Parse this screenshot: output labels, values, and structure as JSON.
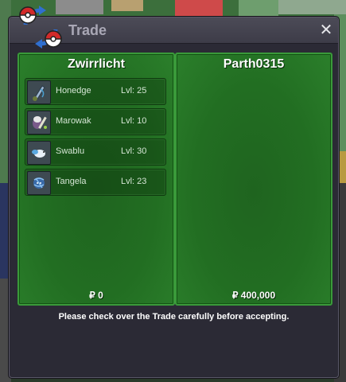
{
  "window": {
    "title": "Trade",
    "close_glyph": "✕",
    "logo_icon": "pokeball-swap-icon"
  },
  "left_panel": {
    "player_name": "Zwirrlicht",
    "money": "₽ 0",
    "pokemon": [
      {
        "name": "Honedge",
        "level": "Lvl: 25",
        "icon": "honedge-sprite-icon"
      },
      {
        "name": "Marowak",
        "level": "Lvl: 10",
        "icon": "marowak-sprite-icon"
      },
      {
        "name": "Swablu",
        "level": "Lvl: 30",
        "icon": "swablu-sprite-icon"
      },
      {
        "name": "Tangela",
        "level": "Lvl: 23",
        "icon": "tangela-sprite-icon"
      }
    ]
  },
  "right_panel": {
    "player_name": "Parth0315",
    "money": "₽ 400,000",
    "pokemon": []
  },
  "notice": "Please check over the Trade carefully before accepting.",
  "colors": {
    "panel_green": "#226e22",
    "window_bg": "#2b2a35",
    "title_text": "#a9a7b5"
  }
}
